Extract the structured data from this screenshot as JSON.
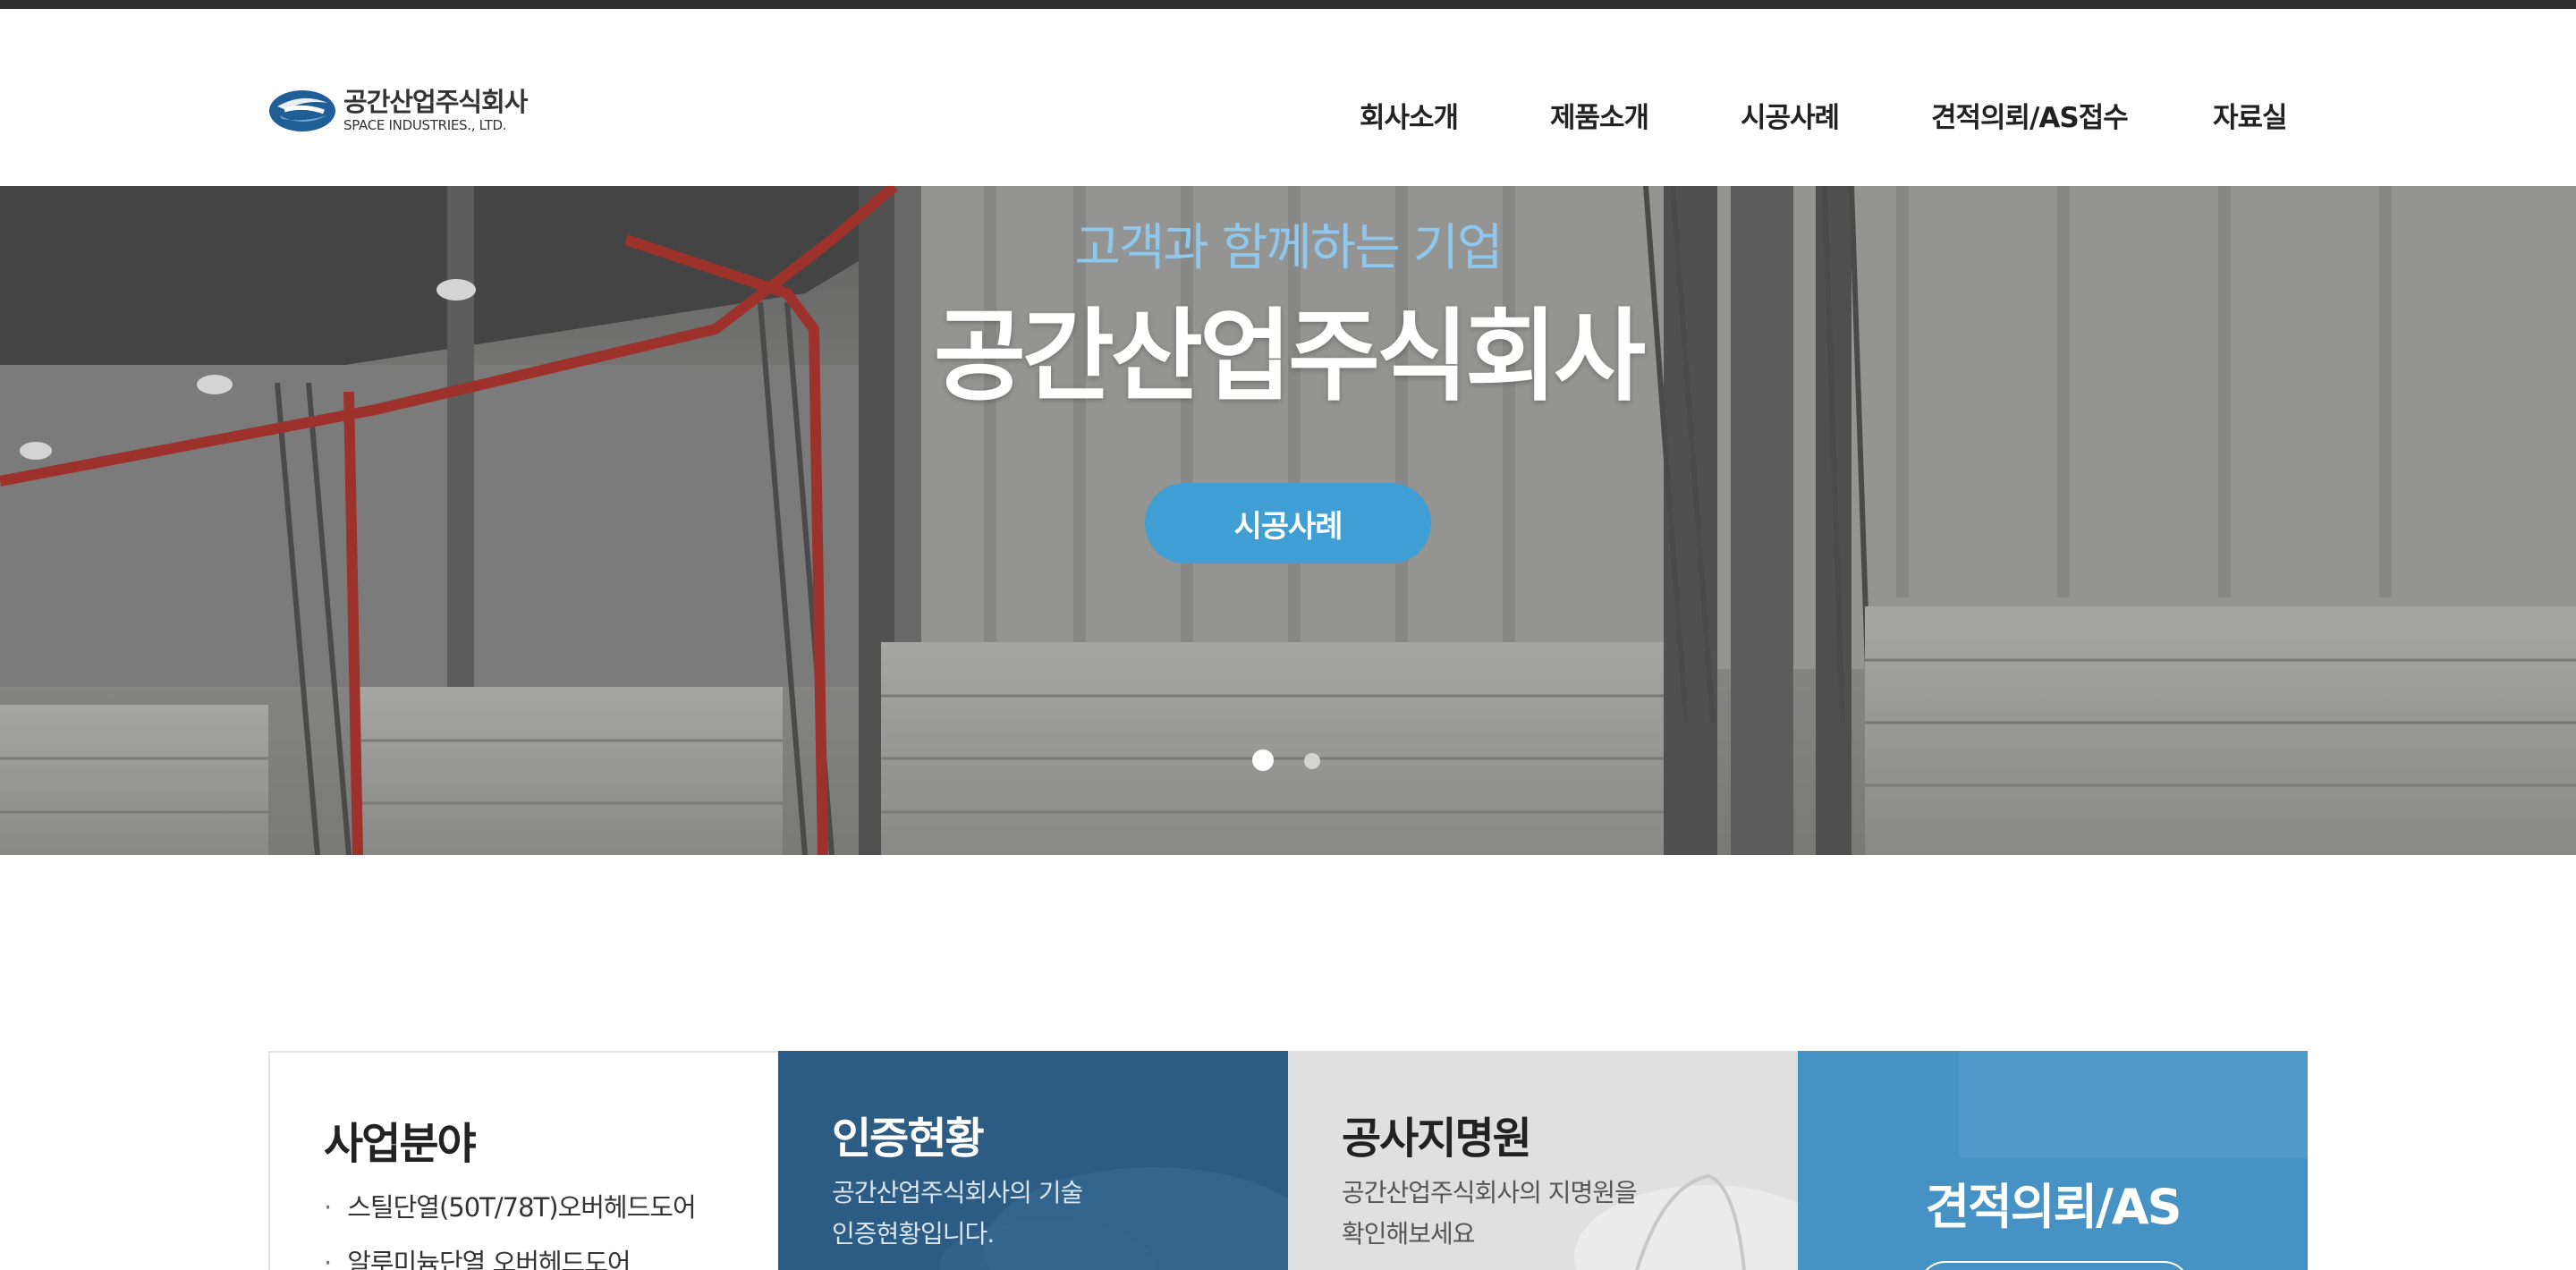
{
  "logo": {
    "name_ko": "공간산업주식회사",
    "name_en": "SPACE INDUSTRIES., LTD."
  },
  "nav": {
    "items": [
      "회사소개",
      "제품소개",
      "시공사례",
      "견적의뢰/AS접수",
      "자료실"
    ]
  },
  "hero": {
    "subtitle": "고객과 함께하는 기업",
    "title": "공간산업주식회사",
    "button_label": "시공사례",
    "slides_total": 2,
    "active_slide": 1
  },
  "cards": [
    {
      "title": "사업분야",
      "items": [
        "스틸단열(50T/78T)오버헤드도어",
        "알루미늄단열 오버헤드도어"
      ]
    },
    {
      "title": "인증현황",
      "description": [
        "공간산업주식회사의 기술",
        "인증현황입니다."
      ]
    },
    {
      "title": "공사지명원",
      "description": [
        "공간산업주식회사의 지명원을",
        "확인해보세요"
      ]
    },
    {
      "title": "견적의뢰/AS"
    }
  ],
  "colors": {
    "accent": "#3f9ed3",
    "hero_subtitle": "#8fc8ee",
    "card_certification": "#2c5b83",
    "card_designation": "#e0e0e0",
    "card_quote": "#4692c4",
    "topbar": "#2f2f2f"
  }
}
